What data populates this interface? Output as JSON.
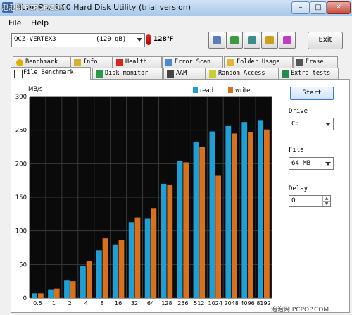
{
  "window": {
    "title": "Tune Pro 4.00 Hard Disk Utility (trial version)",
    "watermark": "泡泡网 PCPOP.COM",
    "minimize": "–",
    "maximize": "□",
    "close": "✕"
  },
  "menu": {
    "file": "File",
    "help": "Help"
  },
  "toolbar": {
    "drive_name": "OCZ-VERTEX3",
    "drive_size": "(120 gB)",
    "temperature": "128℉",
    "exit_label": "Exit",
    "buttons": [
      "copy-icon",
      "save-icon",
      "screenshot-icon",
      "options-icon",
      "download-icon"
    ]
  },
  "tabs_row1": [
    "Benchmark",
    "Info",
    "Health",
    "Error Scan",
    "Folder Usage",
    "Erase"
  ],
  "tabs_row2": [
    "File Benchmark",
    "Disk monitor",
    "AAM",
    "Random Access",
    "Extra tests"
  ],
  "active_tab": "File Benchmark",
  "side": {
    "start_label": "Start",
    "drive_label": "Drive",
    "drive_value": "C:",
    "file_label": "File",
    "file_value": "64 MB",
    "delay_label": "Delay",
    "delay_value": "0"
  },
  "credit": "泡泡网 PCPOP.COM",
  "colors": {
    "read": "#1e9fd6",
    "write": "#d9701c",
    "plot_bg": "#0a0a0a",
    "grid": "#3a3a3a"
  },
  "chart_data": {
    "type": "bar",
    "ylabel": "MB/s",
    "ylim": [
      0,
      300
    ],
    "yticks": [
      0,
      50,
      100,
      150,
      200,
      250,
      300
    ],
    "legend_position": "top-right",
    "grid": true,
    "categories": [
      "0.5",
      "1",
      "2",
      "4",
      "8",
      "16",
      "32",
      "64",
      "128",
      "256",
      "512",
      "1024",
      "2048",
      "4096",
      "8192"
    ],
    "series": [
      {
        "name": "read",
        "values": [
          7,
          13,
          26,
          48,
          71,
          80,
          113,
          118,
          170,
          204,
          232,
          248,
          256,
          262,
          265
        ]
      },
      {
        "name": "write",
        "values": [
          7,
          14,
          25,
          55,
          89,
          86,
          120,
          134,
          168,
          202,
          225,
          182,
          245,
          247,
          251
        ]
      }
    ]
  }
}
